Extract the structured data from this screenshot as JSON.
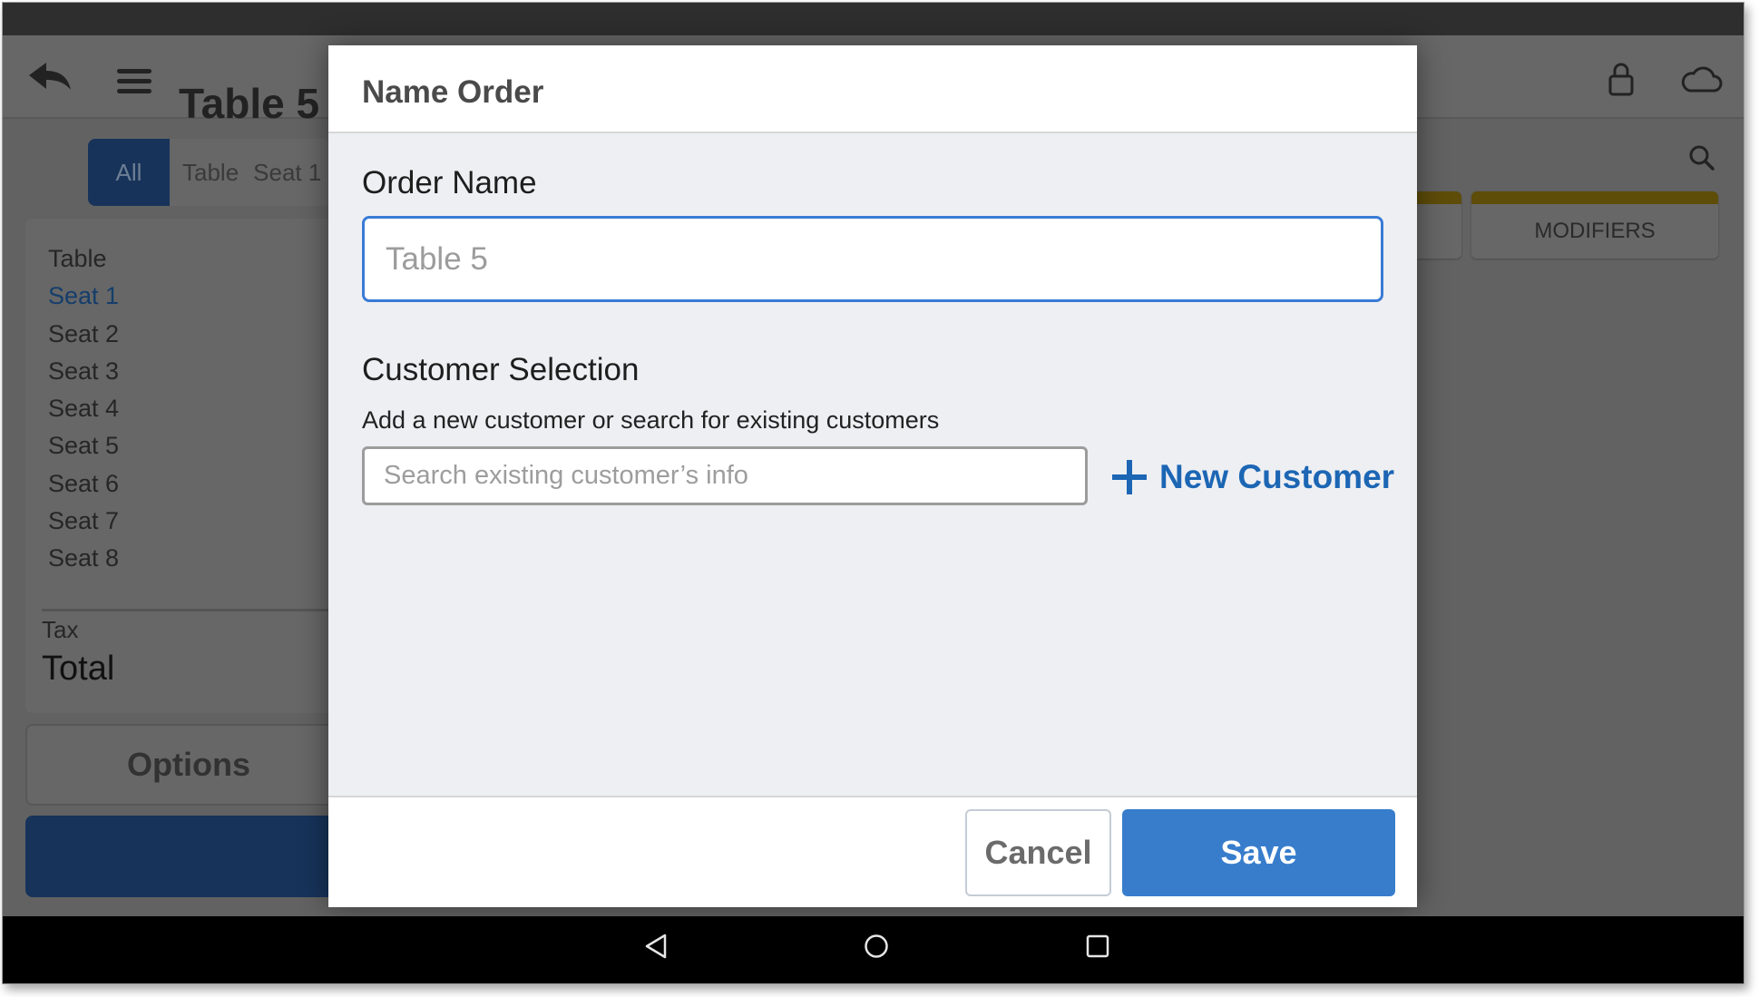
{
  "app_header": {
    "title": "Table 5",
    "icons": [
      "back-arrow-icon",
      "hamburger-menu-icon",
      "lock-icon",
      "cloud-icon"
    ]
  },
  "seat_filter": {
    "tabs": [
      {
        "label": "All",
        "active": true
      },
      {
        "label": "Table",
        "active": false
      },
      {
        "label": "Seat 1",
        "active": false
      }
    ]
  },
  "order_panel": {
    "items": [
      {
        "label": "Table",
        "selected": false
      },
      {
        "label": "Seat 1",
        "selected": true
      },
      {
        "label": "Seat 2",
        "selected": false
      },
      {
        "label": "Seat 3",
        "selected": false
      },
      {
        "label": "Seat 4",
        "selected": false
      },
      {
        "label": "Seat 5",
        "selected": false
      },
      {
        "label": "Seat 6",
        "selected": false
      },
      {
        "label": "Seat 7",
        "selected": false
      },
      {
        "label": "Seat 8",
        "selected": false
      }
    ],
    "tax_label": "Tax",
    "total_label": "Total",
    "options_label": "Options"
  },
  "menu_area": {
    "cards": [
      {
        "label": ""
      },
      {
        "label": "MODIFIERS"
      }
    ],
    "category_color": "#5e4c09"
  },
  "dialog": {
    "title": "Name Order",
    "order_name_label": "Order Name",
    "order_name_value": "",
    "order_name_placeholder": "Table 5",
    "customer_section_label": "Customer Selection",
    "customer_help_text": "Add a new customer or search for existing customers",
    "customer_search_value": "",
    "customer_search_placeholder": "Search existing customer’s info",
    "new_customer_label": "New Customer",
    "cancel_label": "Cancel",
    "save_label": "Save",
    "accent_color": "#377dcc"
  },
  "android_nav": {
    "buttons": [
      "back-icon",
      "home-icon",
      "recents-icon"
    ]
  }
}
